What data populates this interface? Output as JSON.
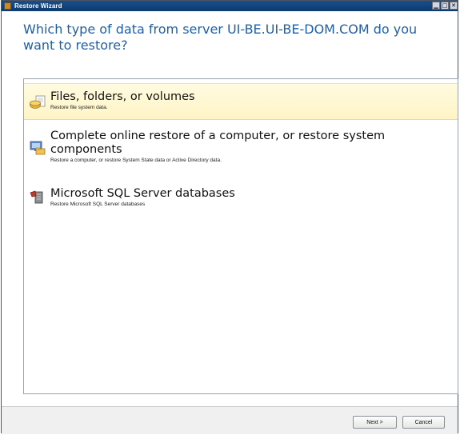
{
  "window": {
    "title": "Restore Wizard"
  },
  "heading": "Which type of data from server UI-BE.UI-BE-DOM.COM do you want to restore?",
  "options": [
    {
      "title": "Files, folders, or volumes",
      "description": "Restore file system data.",
      "icon": "files-folders-icon",
      "selected": true
    },
    {
      "title": "Complete online restore of a computer, or restore system components",
      "description": "Restore a computer, or restore System State data or Active Directory data.",
      "icon": "computer-restore-icon",
      "selected": false
    },
    {
      "title": "Microsoft SQL Server databases",
      "description": "Restore Microsoft SQL Server databases",
      "icon": "sql-server-icon",
      "selected": false
    }
  ],
  "footer": {
    "next_label": "Next >",
    "cancel_label": "Cancel"
  },
  "colors": {
    "heading": "#1f5fa8",
    "selected_bg": "#fff7d1",
    "titlebar": "#0d3a70"
  }
}
